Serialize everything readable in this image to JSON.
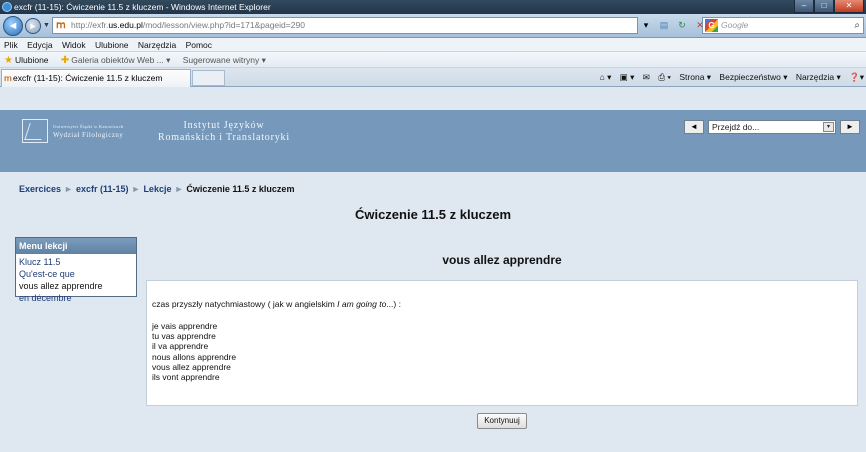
{
  "window": {
    "title": "excfr (11-15): Ćwiczenie 11.5 z kluczem - Windows Internet Explorer",
    "minimize": "–",
    "maximize": "□",
    "close": "✕"
  },
  "address": {
    "url_prefix": "http://exfr.",
    "url_domain": "us.edu.pl",
    "url_rest": "/mod/lesson/view.php?id=171&pageid=290",
    "search_placeholder": "Google",
    "search_brand": "G"
  },
  "menubar": [
    "Plik",
    "Edycja",
    "Widok",
    "Ulubione",
    "Narzędzia",
    "Pomoc"
  ],
  "favorites": {
    "ulubione": "Ulubione",
    "galeria": "Galeria obiektów Web ... ▾",
    "sugerowane": "Sugerowane witryny ▾"
  },
  "tab": {
    "label": "excfr (11-15): Ćwiczenie 11.5 z kluczem"
  },
  "commandbar": [
    "⌂ ▾",
    "▣ ▾",
    "✉",
    "⎙ ▾",
    "Strona ▾",
    "Bezpieczeństwo ▾",
    "Narzędzia ▾",
    "❓▾"
  ],
  "site": {
    "uni_line1": "Uniwersytet Śląski w Katowicach",
    "uni_line2": "Wydział Filologiczny",
    "inst_line1": "Instytut Języków",
    "inst_line2": "Romańskich i Translatoryki",
    "jump_label": "Przejdź do...",
    "jump_prev": "◄",
    "jump_next": "►",
    "jump_arrow": "▾"
  },
  "breadcrumb": {
    "items": [
      "Exercices",
      "excfr (11-15)",
      "Lekcje"
    ],
    "current": "Ćwiczenie 11.5 z kluczem",
    "separator": "►"
  },
  "lesson": {
    "title": "Ćwiczenie 11.5 z kluczem",
    "page_heading": "vous allez apprendre",
    "intro_before": "czas przyszły natychmiastowy ( jak w angielskim ",
    "intro_italic": "I am going to",
    "intro_after": "...) :",
    "conjugation": [
      "je vais apprendre",
      "tu vas apprendre",
      "il va apprendre",
      "nous allons apprendre",
      "vous allez apprendre",
      "ils vont apprendre"
    ],
    "continue_label": "Kontynuuj"
  },
  "lesson_menu": {
    "title": "Menu lekcji",
    "items": [
      "Klucz 11.5",
      "Qu'est-ce que",
      "vous allez apprendre",
      "en décembre"
    ]
  }
}
